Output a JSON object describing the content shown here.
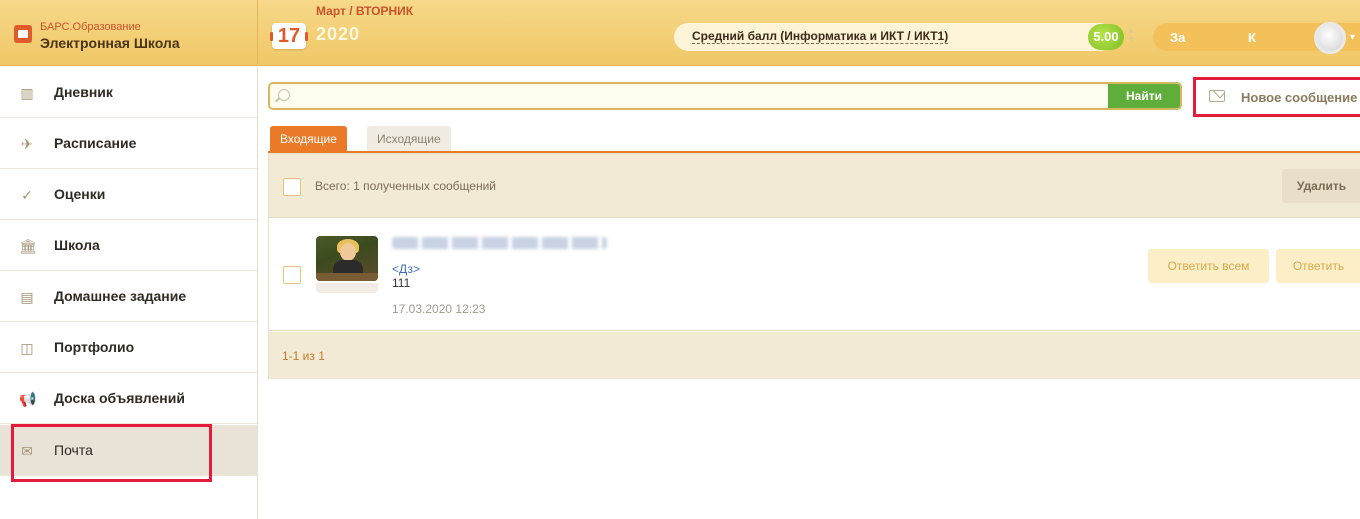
{
  "logo": {
    "line1": "БАРС.Образование",
    "line2": "Электронная Школа"
  },
  "date": {
    "day": "17",
    "month_weekday": "Март / ВТОРНИК",
    "year": "2020"
  },
  "average": {
    "label": "Средний балл (Информатика и ИКТ / ИКТ1)",
    "score": "5.00",
    "arrows_icon": "up-down-arrows-icon"
  },
  "user": {
    "name_part1": "За",
    "name_part2": "К",
    "avatar_icon": "avatar-icon",
    "chevron": "▾"
  },
  "sidebar": {
    "items": [
      {
        "label": "Дневник",
        "icon": "book-icon",
        "glyph": "▥"
      },
      {
        "label": "Расписание",
        "icon": "paper-plane-icon",
        "glyph": "✈"
      },
      {
        "label": "Оценки",
        "icon": "checkmark-icon",
        "glyph": "✓"
      },
      {
        "label": "Школа",
        "icon": "school-building-icon",
        "glyph": "🏛"
      },
      {
        "label": "Домашнее задание",
        "icon": "homework-icon",
        "glyph": "▤"
      },
      {
        "label": "Портфолио",
        "icon": "portfolio-icon",
        "glyph": "◫"
      },
      {
        "label": "Доска объявлений",
        "icon": "megaphone-icon",
        "glyph": "📢"
      },
      {
        "label": "Почта",
        "icon": "mail-icon",
        "glyph": "✉"
      }
    ]
  },
  "search": {
    "placeholder": "",
    "button_label": "Найти"
  },
  "new_message": {
    "label": "Новое сообщение"
  },
  "tabs": {
    "inbox": "Входящие",
    "outbox": "Исходящие"
  },
  "toolbar": {
    "total_label": "Всего: 1 полученных сообщений",
    "delete_label": "Удалить"
  },
  "messages": [
    {
      "subject": "<Дз>",
      "body": "111",
      "date": "17.03.2020 12:23",
      "reply_all_label": "Ответить всем",
      "reply_label": "Ответить"
    }
  ],
  "pager": {
    "text": "1-1 из 1"
  },
  "colors": {
    "accent_orange": "#eb7a28",
    "header_yellow": "#f0c766",
    "search_green": "#5fae3c",
    "highlight_red": "#e41b3a"
  }
}
